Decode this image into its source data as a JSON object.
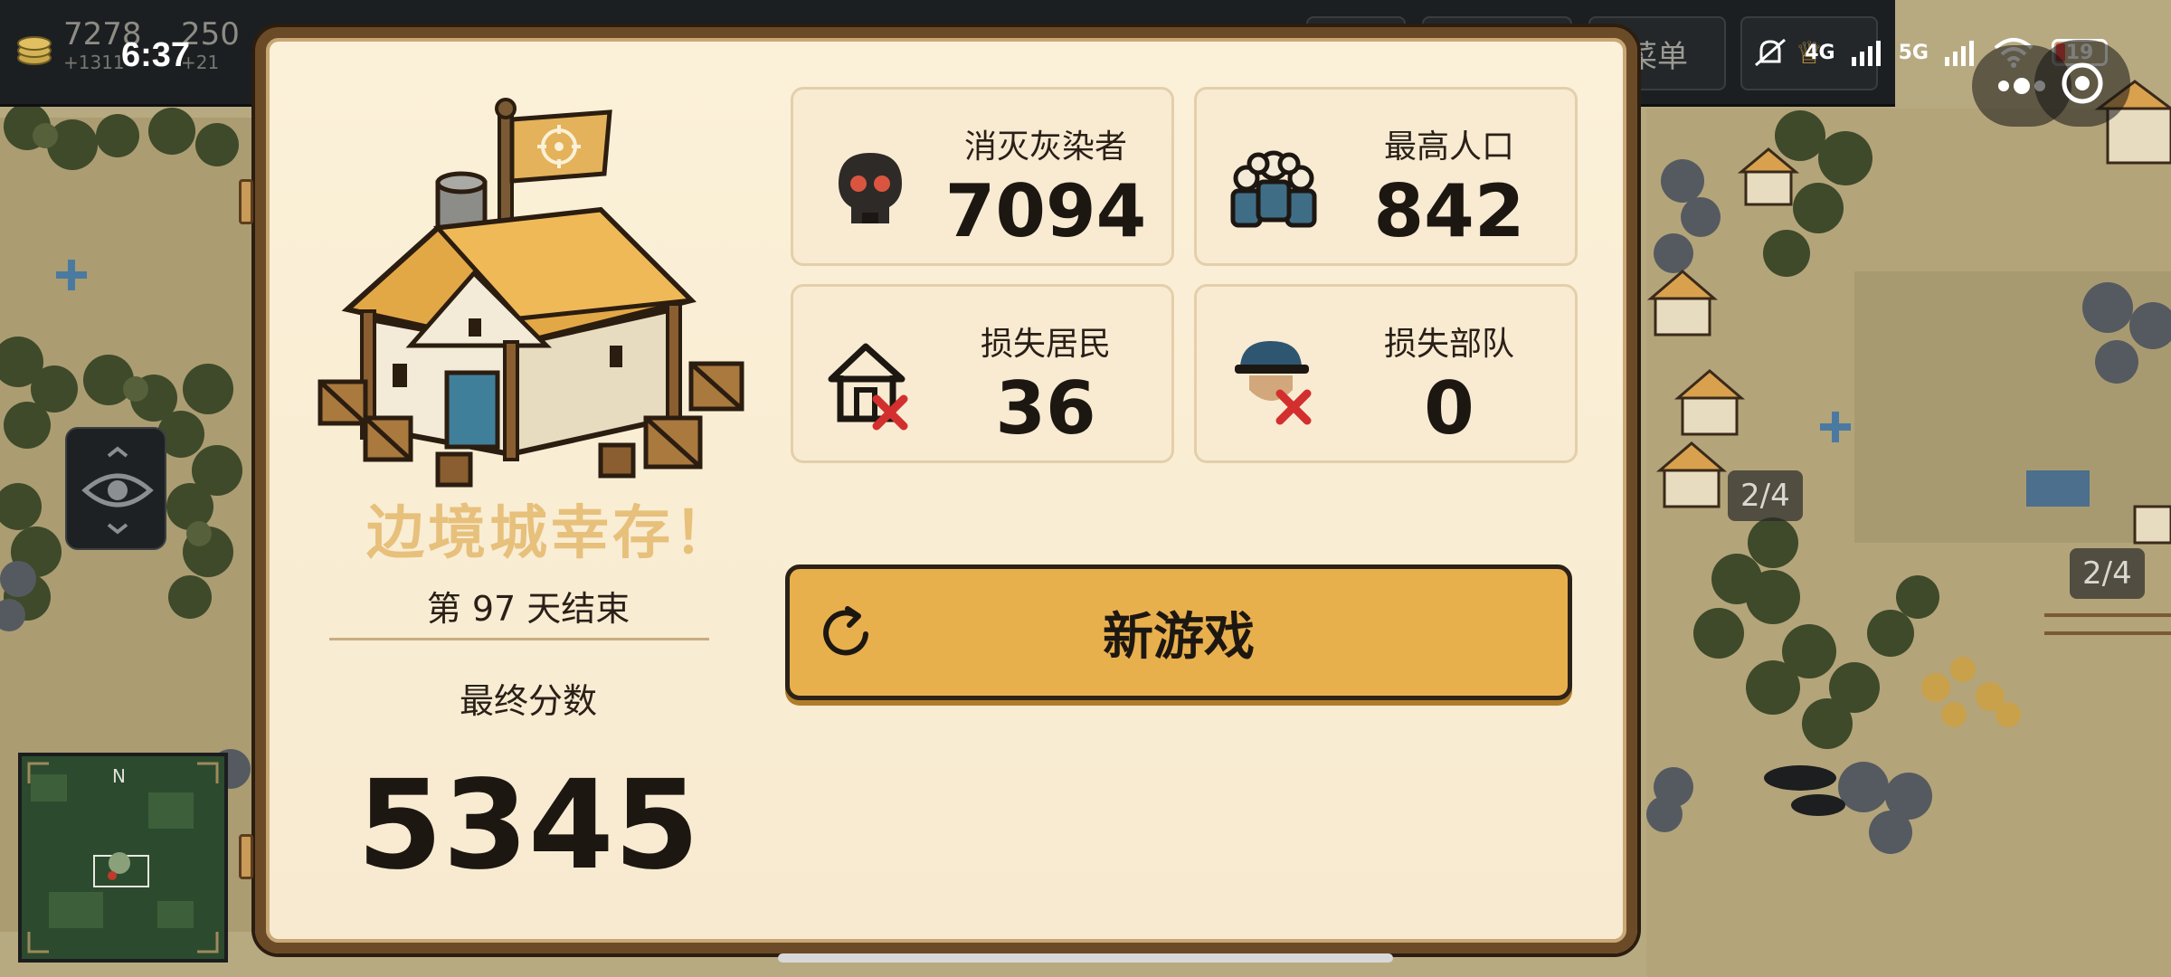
{
  "hud": {
    "gold_value": "7278",
    "gold_delta": "+1311",
    "second_value": "250",
    "second_delta": "+21",
    "menu_label": "菜单",
    "crown_label": "♕",
    "time": "6:37"
  },
  "status_bar": {
    "network_4g": "4G",
    "network_5g": "5G",
    "battery_level": "19",
    "wifi_sub": "6"
  },
  "minimap": {
    "north_label": "N"
  },
  "map_badges": [
    "2/4",
    "2/4"
  ],
  "dialog": {
    "title": "边境城幸存！",
    "day_text": "第 97 天结束",
    "final_score_label": "最终分数",
    "final_score": "5345",
    "stats": [
      {
        "label": "消灭灰染者",
        "value": "7094",
        "icon": "skull-icon"
      },
      {
        "label": "最高人口",
        "value": "842",
        "icon": "population-icon"
      },
      {
        "label": "损失居民",
        "value": "36",
        "icon": "lost-house-icon"
      },
      {
        "label": "损失部队",
        "value": "0",
        "icon": "lost-soldier-icon"
      }
    ],
    "new_game_label": "新游戏"
  },
  "colors": {
    "accent_button": "#e8b04d",
    "title_gold": "#e7c07b",
    "panel_bg": "#fbf1d8",
    "frame_brown": "#6b4b27",
    "danger_red": "#d32f2f"
  }
}
